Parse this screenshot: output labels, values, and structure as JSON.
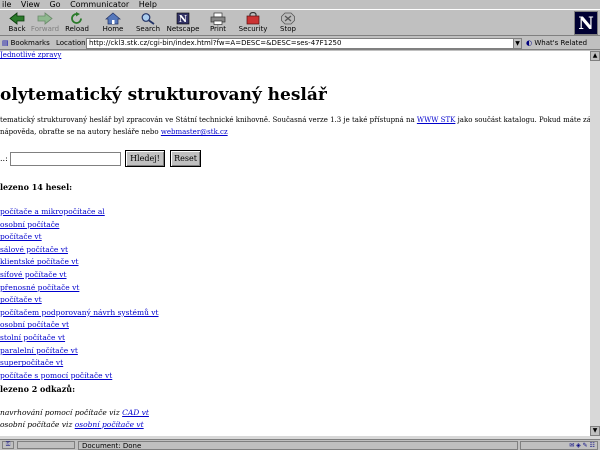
{
  "menu": [
    "ile",
    "View",
    "Go",
    "Communicator",
    "Help"
  ],
  "toolbar": {
    "buttons": [
      {
        "label": "Back",
        "icon": "back-arrow-icon",
        "disabled": false
      },
      {
        "label": "Forward",
        "icon": "forward-arrow-icon",
        "disabled": true
      },
      {
        "label": "Reload",
        "icon": "reload-icon",
        "disabled": false
      },
      {
        "label": "Home",
        "icon": "home-icon",
        "disabled": false
      },
      {
        "label": "Search",
        "icon": "search-icon",
        "disabled": false
      },
      {
        "label": "Netscape",
        "icon": "netscape-icon",
        "disabled": false
      },
      {
        "label": "Print",
        "icon": "print-icon",
        "disabled": false
      },
      {
        "label": "Security",
        "icon": "security-icon",
        "disabled": false
      },
      {
        "label": "Stop",
        "icon": "stop-icon",
        "disabled": false
      }
    ],
    "logo": "N"
  },
  "location_bar": {
    "bookmarks_label": "Bookmarks",
    "location_label": "Location",
    "url": "http://ckl3.stk.cz/cgi-bin/index.html?fw=A=DESC=&DESC=ses-47F1250",
    "related_label": "What's Related"
  },
  "content": {
    "top_link": "Jednotlivé zpravy",
    "title": "olytematický strukturovaný heslář",
    "intro_line1": "tematický strukturovaný heslář byl zpracován ve Státní technické knihovně. Současná verze 1.3 je také přístupná na ",
    "intro_link1": "WWW STK",
    "intro_line1_end": " jako součást katalogu. Pokud máte zájem o",
    "intro_line2": " nápověda, obraťte se na autory hesláře nebo ",
    "intro_link2": "webmaster@stk.cz",
    "search_label": "..:",
    "search_value": "",
    "search_button": "Hledej!",
    "reset_button": "Reset",
    "section1_heading": "lezeno 14 hesel:",
    "section1_items": [
      "počítače a mikropočítače al",
      "osobní počítače",
      "počítače vt",
      "sálové počítače vt",
      "klientské počítače vt",
      "síťové počítače vt",
      "přenosné počítače vt",
      "počítače vt",
      "počítačem podporovaný návrh systémů vt",
      "osobní počítače vt",
      "stolní počítače vt",
      "paralelní počítače vt",
      "superpočítače vt",
      "počítače s pomocí počítače vt"
    ],
    "section2_heading": "lezeno 2 odkazů:",
    "section2_refs": [
      {
        "prefix": "navrhování pomocí počítače viz ",
        "link": "CAD vt"
      },
      {
        "prefix": "osobní počítače viz ",
        "link": "osobní počítače vt"
      }
    ]
  },
  "status": {
    "text": "Document: Done"
  }
}
